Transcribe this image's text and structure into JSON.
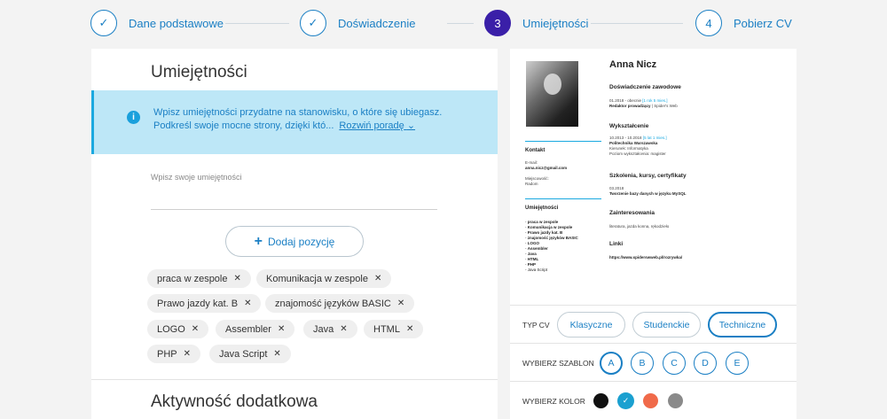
{
  "stepper": {
    "steps": [
      {
        "label": "Dane podstawowe",
        "symbol": "✓"
      },
      {
        "label": "Doświadczenie",
        "symbol": "✓"
      },
      {
        "label": "Umiejętności",
        "symbol": "3"
      },
      {
        "label": "Pobierz CV",
        "symbol": "4"
      }
    ]
  },
  "skills": {
    "title": "Umiejętności",
    "info_text": "Wpisz umiejętności przydatne na stanowisku, o które się ubiegasz. Podkreśl swoje mocne strony, dzięki któ...",
    "info_more": "Rozwiń poradę",
    "input_placeholder": "Wpisz swoje umiejętności",
    "add_label": "Dodaj pozycję",
    "tags": [
      "praca w zespole",
      "Komunikacja w zespole",
      "Prawo jazdy kat. B",
      "znajomość języków BASIC",
      "LOGO",
      "Assembler",
      "Java",
      "HTML",
      "PHP",
      "Java Script"
    ],
    "next_section_title": "Aktywność dodatkowa"
  },
  "cv": {
    "name": "Anna Nicz",
    "experience_heading": "Doświadczenie zawodowe",
    "experience_date": "01.2018 - obecnie",
    "experience_duration": "[1 rok 5 mies.]",
    "experience_role": "Redaktor prowadzący",
    "experience_company": "Spider's Web",
    "education_heading": "Wykształcenie",
    "education_date": "10.2013 - 10.2018",
    "education_duration": "[5 lat 1 mies.]",
    "education_school": "Politechnika Warszawska",
    "education_field": "Kierunek: Informatyka",
    "education_level": "Poziom wykształcenia: magister",
    "courses_heading": "Szkolenia, kursy, certyfikaty",
    "course_date": "03.2018",
    "course_name": "Tworzenie bazy danych w języku MySQL",
    "interests_heading": "Zainteresowania",
    "interests_text": "literatura, jazda konna, rękodzieło",
    "links_heading": "Linki",
    "links_text": "https://www.spiderswweb.pl/rozrywka/",
    "contact_heading": "Kontakt",
    "email_label": "E-mail:",
    "email_value": "anna.nicz@gmail.com",
    "city_label": "Miejscowość:",
    "city_value": "Radom",
    "skills_heading": "Umiejętności",
    "skills_list": [
      "praca w zespole",
      "Komunikacja w zespole",
      "Prawo jazdy kat. B",
      "znajomość języków BASIC",
      "LOGO",
      "Assembler",
      "Java",
      "HTML",
      "PHP",
      "Java Script"
    ]
  },
  "options": {
    "type_label": "TYP CV",
    "types": [
      "Klasyczne",
      "Studenckie",
      "Techniczne"
    ],
    "template_label": "WYBIERZ SZABLON",
    "templates": [
      "A",
      "B",
      "C",
      "D",
      "E"
    ],
    "color_label": "WYBIERZ KOLOR",
    "colors": [
      "#111111",
      "#1aa0d0",
      "#f06a4a",
      "#8a8a8a"
    ],
    "selected_color_mark": "✓"
  }
}
